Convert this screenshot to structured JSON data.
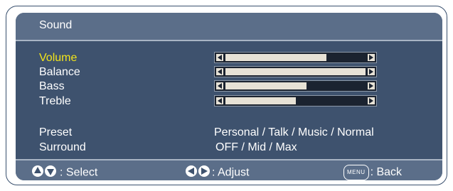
{
  "title": "Sound",
  "items": [
    {
      "label": "Volume",
      "active": true,
      "level": 0.72
    },
    {
      "label": "Balance",
      "active": false,
      "level": 1.0
    },
    {
      "label": "Bass",
      "active": false,
      "level": 0.58
    },
    {
      "label": "Treble",
      "active": false,
      "level": 0.5
    }
  ],
  "preset": {
    "label": "Preset",
    "value": "Personal / Talk / Music / Normal"
  },
  "surround": {
    "label": "Surround",
    "value": "OFF / Mid / Max"
  },
  "footer": {
    "select": ": Select",
    "adjust": ": Adjust",
    "menu_badge": "MENU",
    "back": ": Back"
  },
  "icons": {
    "select": "up-down-circle-icon",
    "adjust": "left-right-circle-icon",
    "menu": "menu-button-icon"
  },
  "colors": {
    "panel": "#3e526e",
    "header": "#5b6e89",
    "active_text": "#f3e51a",
    "text": "#ffffff",
    "bar_fill": "#e7e2d6"
  }
}
